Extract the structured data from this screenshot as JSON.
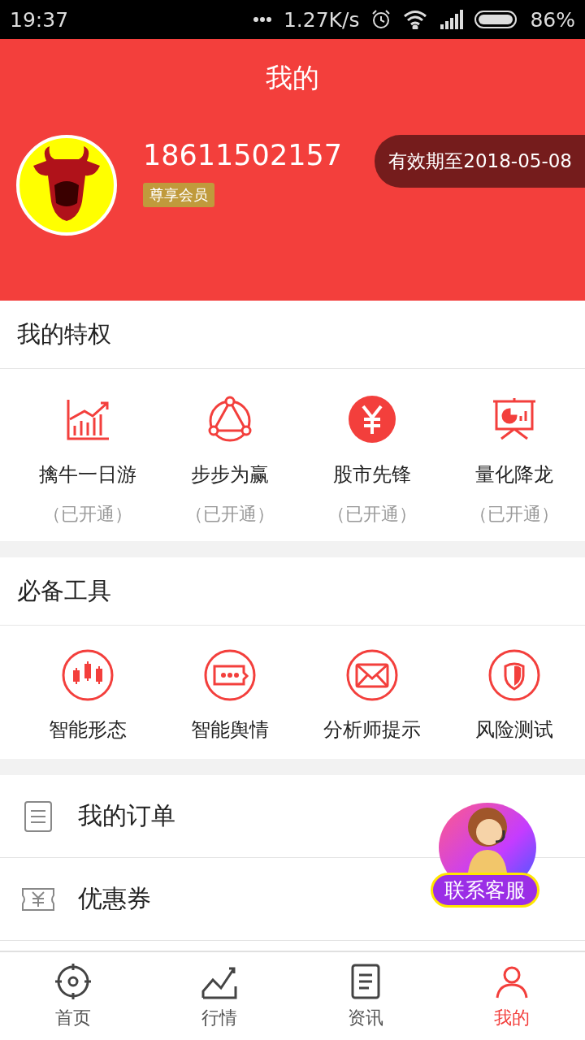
{
  "status_bar": {
    "time": "19:37",
    "network_speed": "1.27K/s",
    "battery": "86%"
  },
  "header": {
    "title": "我的",
    "phone": "18611502157",
    "badge": "尊享会员",
    "expiry": "有效期至2018-05-08"
  },
  "privileges": {
    "title": "我的特权",
    "items": [
      {
        "label": "擒牛一日游",
        "status": "（已开通）",
        "kind": "chart"
      },
      {
        "label": "步步为赢",
        "status": "（已开通）",
        "kind": "triangle"
      },
      {
        "label": "股市先锋",
        "status": "（已开通）",
        "kind": "yen"
      },
      {
        "label": "量化降龙",
        "status": "（已开通）",
        "kind": "board"
      }
    ]
  },
  "tools": {
    "title": "必备工具",
    "items": [
      {
        "label": "智能形态",
        "kind": "candles"
      },
      {
        "label": "智能舆情",
        "kind": "chat"
      },
      {
        "label": "分析师提示",
        "kind": "mail"
      },
      {
        "label": "风险测试",
        "kind": "shield"
      }
    ]
  },
  "menu": {
    "items": [
      {
        "label": "我的订单",
        "kind": "orders"
      },
      {
        "label": "优惠券",
        "kind": "coupon"
      }
    ]
  },
  "service_button": {
    "label": "联系客服"
  },
  "tabs": [
    {
      "label": "首页",
      "kind": "target",
      "selected": false
    },
    {
      "label": "行情",
      "kind": "trend",
      "selected": false
    },
    {
      "label": "资讯",
      "kind": "news",
      "selected": false
    },
    {
      "label": "我的",
      "kind": "person",
      "selected": true
    }
  ]
}
